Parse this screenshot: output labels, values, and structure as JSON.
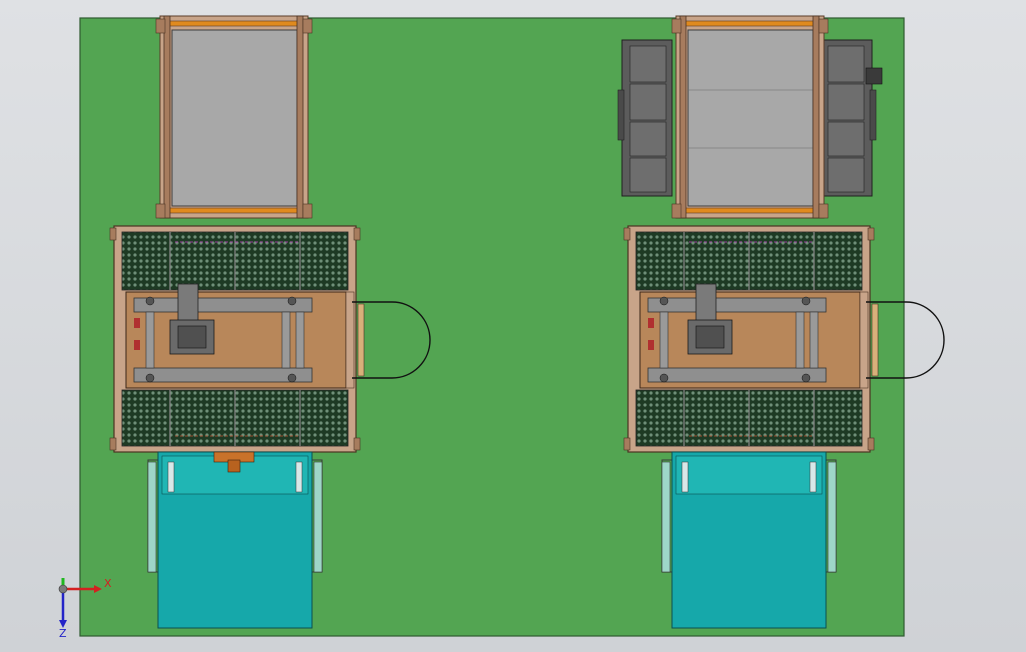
{
  "viewport": {
    "background": "#d8dadd"
  },
  "floor": {
    "color": "#53a552",
    "edge": "#2f5a30"
  },
  "triad": {
    "x_label": "X",
    "z_label": "Z",
    "x_color": "#d42020",
    "y_color": "#1fb81f",
    "z_color": "#2424c8"
  },
  "palette": {
    "frame": "#a77c5e",
    "rail": "#e08a1e",
    "glass": "#a8a8a8",
    "mesh": "#1e3a24",
    "deck": "#b8875a",
    "beam": "#8f8f8f",
    "cyan": "#16a8aa",
    "dark_unit": "#5c5c5c"
  },
  "components": [
    {
      "kind": "rack-table"
    },
    {
      "kind": "rack-table-with-side-units"
    },
    {
      "kind": "mesh-guarded-station"
    },
    {
      "kind": "mesh-guarded-station"
    },
    {
      "kind": "cyan-conveyor"
    },
    {
      "kind": "cyan-conveyor"
    },
    {
      "kind": "handle-loop"
    },
    {
      "kind": "handle-loop"
    }
  ]
}
